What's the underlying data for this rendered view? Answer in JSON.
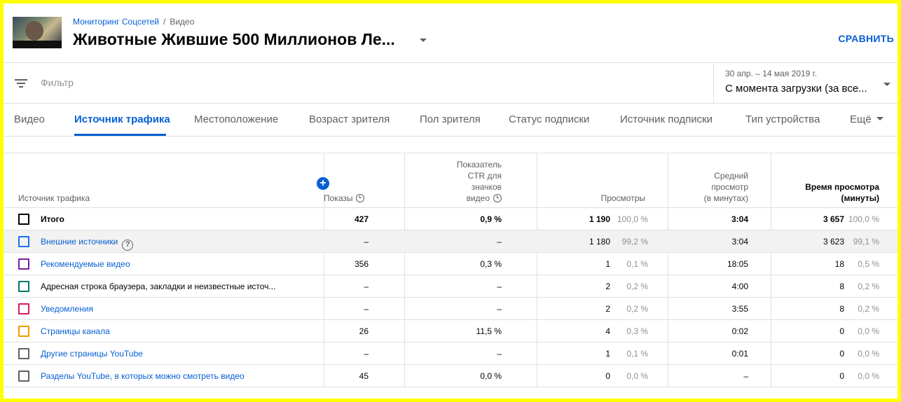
{
  "header": {
    "breadcrumb_root": "Мониторинг Соцсетей",
    "breadcrumb_separator": "/",
    "breadcrumb_current": "Видео",
    "title": "Животные Жившие 500 Миллионов Ле...",
    "compare_label": "СРАВНИТЬ"
  },
  "filter": {
    "placeholder": "Фильтр",
    "date_range_sub": "30 апр. – 14 мая 2019 г.",
    "date_range_main": "С момента загрузки (за все..."
  },
  "tabs": [
    {
      "label": "Видео"
    },
    {
      "label": "Источник трафика"
    },
    {
      "label": "Местоположение"
    },
    {
      "label": "Возраст зрителя"
    },
    {
      "label": "Пол зрителя"
    },
    {
      "label": "Статус подписки"
    },
    {
      "label": "Источник подписки"
    },
    {
      "label": "Тип устройства"
    },
    {
      "label": "Ещё"
    }
  ],
  "table": {
    "columns": {
      "source": "Источник трафика",
      "impressions": "Показы",
      "ctr": [
        "Показатель",
        "CTR для",
        "значков",
        "видео"
      ],
      "views": "Просмотры",
      "avg_view": [
        "Средний",
        "просмотр",
        "(в минутах)"
      ],
      "watch_time": [
        "Время просмотра",
        "(минуты)"
      ]
    },
    "rows": [
      {
        "label": "Итого",
        "impressions": "427",
        "ctr": "0,9 %",
        "views": "1 190",
        "views_pct": "100,0 %",
        "avg": "3:04",
        "watch": "3 657",
        "watch_pct": "100,0 %",
        "color": "#030303"
      },
      {
        "label": "Внешние источники",
        "impressions": "–",
        "ctr": "–",
        "views": "1 180",
        "views_pct": "99,2 %",
        "avg": "3:04",
        "watch": "3 623",
        "watch_pct": "99,1 %",
        "color": "#1a73e8"
      },
      {
        "label": "Рекомендуемые видео",
        "impressions": "356",
        "ctr": "0,3 %",
        "views": "1",
        "views_pct": "0,1 %",
        "avg": "18:05",
        "watch": "18",
        "watch_pct": "0,5 %",
        "color": "#7b1fa2"
      },
      {
        "label": "Адресная строка браузера, закладки и неизвестные источ...",
        "impressions": "–",
        "ctr": "–",
        "views": "2",
        "views_pct": "0,2 %",
        "avg": "4:00",
        "watch": "8",
        "watch_pct": "0,2 %",
        "color": "#00796b"
      },
      {
        "label": "Уведомления",
        "impressions": "–",
        "ctr": "–",
        "views": "2",
        "views_pct": "0,2 %",
        "avg": "3:55",
        "watch": "8",
        "watch_pct": "0,2 %",
        "color": "#d81b60"
      },
      {
        "label": "Страницы канала",
        "impressions": "26",
        "ctr": "11,5 %",
        "views": "4",
        "views_pct": "0,3 %",
        "avg": "0:02",
        "watch": "0",
        "watch_pct": "0,0 %",
        "color": "#f29900"
      },
      {
        "label": "Другие страницы YouTube",
        "impressions": "–",
        "ctr": "–",
        "views": "1",
        "views_pct": "0,1 %",
        "avg": "0:01",
        "watch": "0",
        "watch_pct": "0,0 %",
        "color": "#616161"
      },
      {
        "label": "Разделы YouTube, в которых можно смотреть видео",
        "impressions": "45",
        "ctr": "0,0 %",
        "views": "0",
        "views_pct": "0,0 %",
        "avg": "–",
        "watch": "0",
        "watch_pct": "0,0 %",
        "color": "#616161"
      }
    ]
  }
}
